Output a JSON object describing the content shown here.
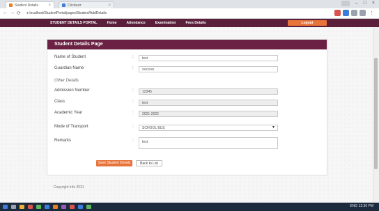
{
  "browser": {
    "tabs": [
      {
        "title": "Student Details"
      },
      {
        "title": "Cricbuzz"
      }
    ],
    "url": "localhost/StudentPortal/pages/Student/AddDetails"
  },
  "header": {
    "menu": [
      "STUDENT DETAILS PORTAL",
      "Home",
      "Attendance",
      "Examination",
      "Fees Details"
    ],
    "logout_label": "Logout"
  },
  "form": {
    "title": "Student Details Page",
    "fields": [
      {
        "label": "Name of Student",
        "value": "test"
      },
      {
        "label": "Guardian Name",
        "value": "xxxxxxx"
      },
      {
        "label": "Admission Number",
        "value": "12345"
      },
      {
        "label": "Class",
        "value": "test"
      },
      {
        "label": "Academic Year",
        "value": "2021-2022"
      },
      {
        "label": "Mode of Transport",
        "value": "SCHOOL BUS"
      },
      {
        "label": "Remarks",
        "value": "test"
      }
    ],
    "section_label": "Other Details",
    "submit_label": "Save Student Details",
    "back_label": "Back to List"
  },
  "footer": {
    "text": "Copyright Info 2021"
  },
  "taskbar": {
    "tray_text": "ENG 12:30 PM"
  },
  "colors": {
    "header": "#5a1f3a",
    "card_header": "#6b2143",
    "accent": "#e8743b",
    "taskbar": "#1c2a3d"
  }
}
